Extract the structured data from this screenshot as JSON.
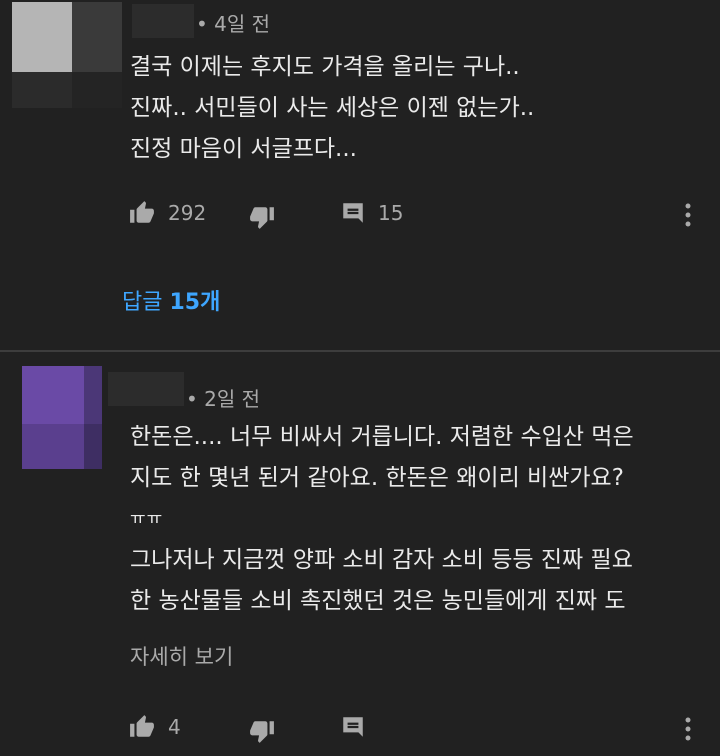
{
  "comments": [
    {
      "time": "4일 전",
      "lines": [
        "결국 이제는 후지도 가격을 올리는 구나..",
        "진짜.. 서민들이 사는 세상은 이젠 없는가..",
        "진정 마음이 서글프다..."
      ],
      "likes": "292",
      "reply_count": "15",
      "replies_prefix": "답글",
      "replies_count_label": "15개"
    },
    {
      "time": "2일 전",
      "lines": [
        "한돈은.... 너무 비싸서 거릅니다. 저렴한 수입산 먹은",
        "지도 한 몇년 된거 같아요. 한돈은 왜이리 비싼가요?",
        "ㅠㅠ",
        "그나저나 지금껏 양파 소비 감자 소비 등등 진짜 필요",
        "한 농산물들 소비 촉진했던 것은 농민들에게 진짜 도"
      ],
      "read_more": "자세히 보기",
      "likes": "4"
    }
  ],
  "icons": {
    "like": "thumbs-up-icon",
    "dislike": "thumbs-down-icon",
    "reply": "comment-icon",
    "menu": "more-vertical-icon"
  },
  "colors": {
    "background": "#212121",
    "link": "#3ea6ff",
    "secondary": "#aaaaaa",
    "text": "#eaeaea"
  }
}
